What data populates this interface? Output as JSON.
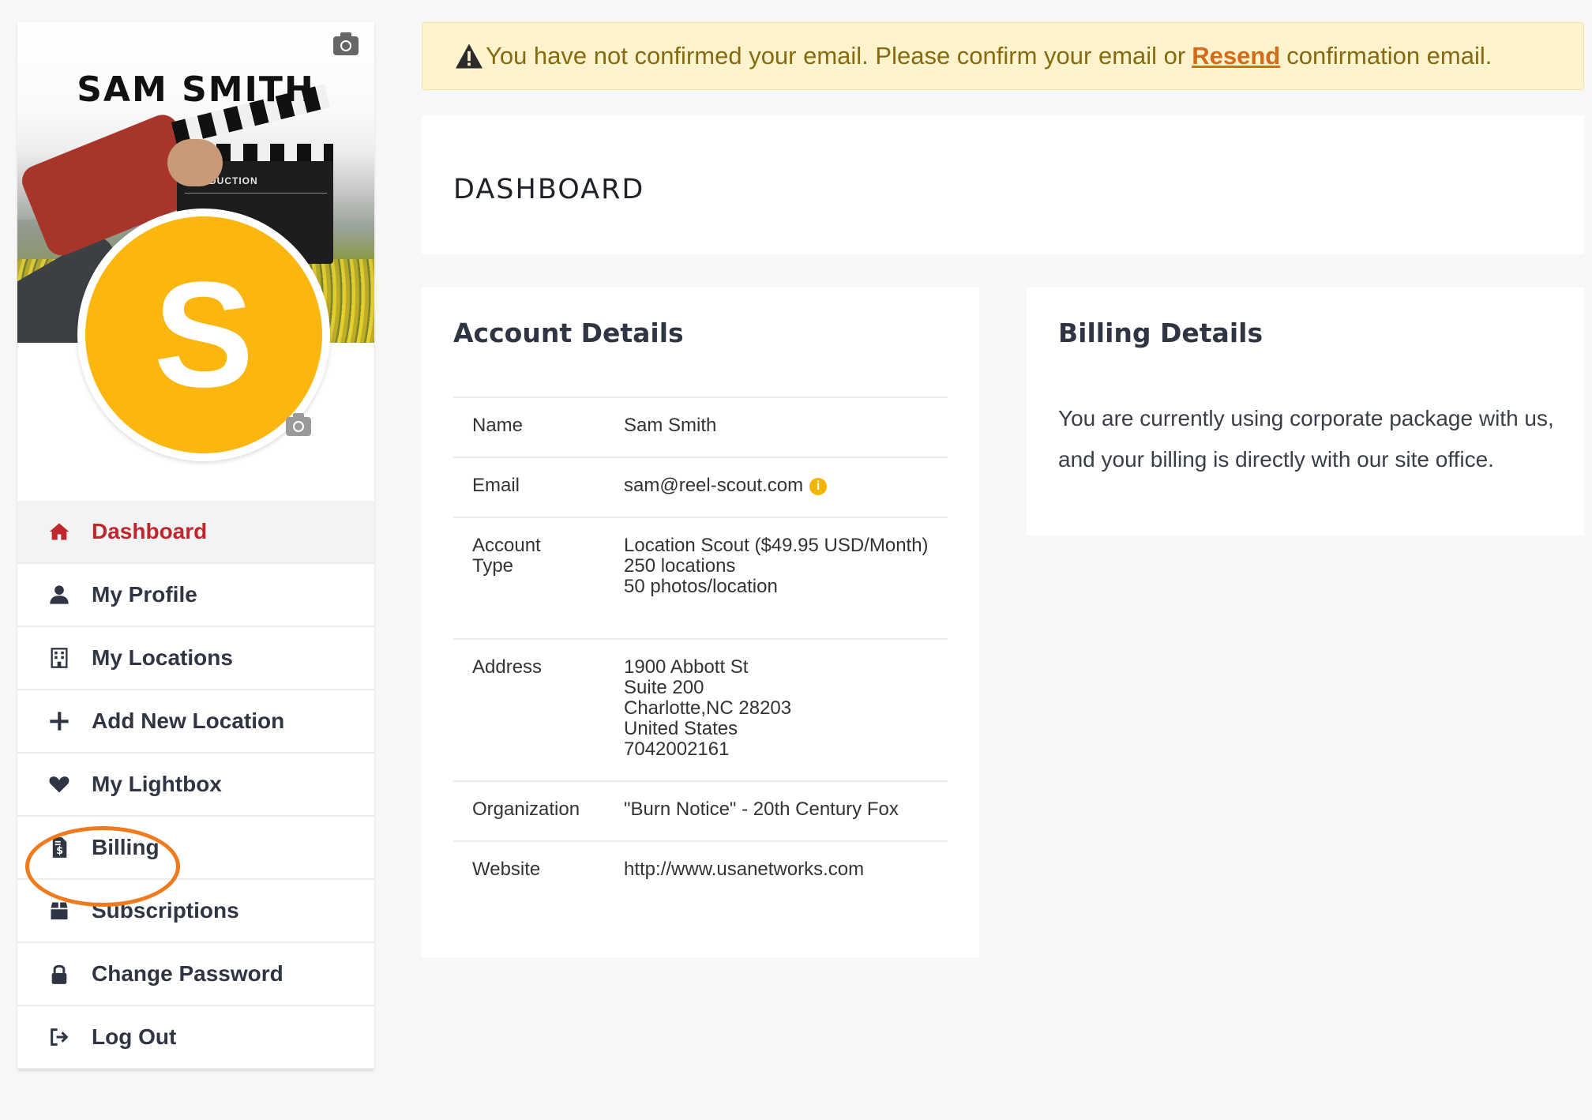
{
  "profile": {
    "name": "SAM SMITH",
    "avatar_initial": "S",
    "cover_clapper_text": "PRODUCTION"
  },
  "menu": {
    "items": [
      {
        "label": "Dashboard",
        "icon": "home-icon",
        "active": true
      },
      {
        "label": "My Profile",
        "icon": "user-icon"
      },
      {
        "label": "My Locations",
        "icon": "building-icon"
      },
      {
        "label": "Add New Location",
        "icon": "plus-icon"
      },
      {
        "label": "My Lightbox",
        "icon": "heart-icon"
      },
      {
        "label": "Billing",
        "icon": "invoice-icon"
      },
      {
        "label": "Subscriptions",
        "icon": "box-icon"
      },
      {
        "label": "Change Password",
        "icon": "lock-icon"
      },
      {
        "label": "Log Out",
        "icon": "logout-icon"
      }
    ]
  },
  "alert": {
    "before": "You have not confirmed your email. Please confirm your email or",
    "link": "Resend",
    "after": "confirmation email."
  },
  "dashboard": {
    "title": "DASHBOARD"
  },
  "account": {
    "title": "Account Details",
    "rows": [
      {
        "label": "Name",
        "value": "Sam Smith"
      },
      {
        "label": "Email",
        "value": "sam@reel-scout.com"
      },
      {
        "label": "Account Type",
        "value": "Location Scout ($49.95 USD/Month)\n250 locations\n50 photos/location"
      },
      {
        "label": "Address",
        "value": "1900 Abbott St\nSuite 200\nCharlotte,NC 28203\nUnited States\n7042002161"
      },
      {
        "label": "Organization",
        "value": "\"Burn Notice\" - 20th Century Fox"
      },
      {
        "label": "Website",
        "value": "http://www.usanetworks.com"
      }
    ]
  },
  "billing": {
    "title": "Billing Details",
    "text": "You are currently using corporate package with us, and your billing is directly with our site office."
  },
  "colors": {
    "active": "#c0262d",
    "avatar": "#fbb60f",
    "alert_bg": "#fdf3cd",
    "alert_text": "#866a10",
    "link": "#d56a18",
    "highlight": "#f07a1c"
  }
}
